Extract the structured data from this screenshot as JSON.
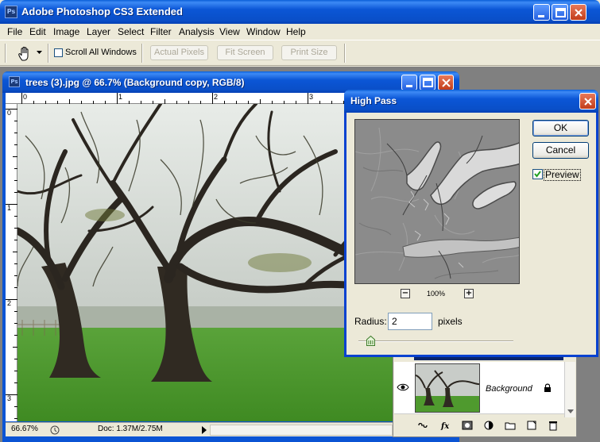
{
  "app": {
    "title": "Adobe Photoshop CS3 Extended",
    "icon_text": "Ps"
  },
  "menu": [
    "File",
    "Edit",
    "Image",
    "Layer",
    "Select",
    "Filter",
    "Analysis",
    "View",
    "Window",
    "Help"
  ],
  "options": {
    "scroll_all_windows": "Scroll All Windows",
    "scroll_all_checked": false,
    "actual_pixels": "Actual Pixels",
    "fit_screen": "Fit Screen",
    "print_size": "Print Size"
  },
  "document": {
    "title": "trees (3).jpg @ 66.7% (Background copy, RGB/8)",
    "icon_text": "Ps",
    "ruler_h": [
      "0",
      "1",
      "2",
      "3"
    ],
    "ruler_v": [
      "0",
      "1",
      "2",
      "3"
    ],
    "zoom": "66.67%",
    "doc_size": "Doc: 1.37M/2.75M"
  },
  "layers": {
    "background_name": "Background"
  },
  "dialog": {
    "title": "High Pass",
    "ok": "OK",
    "cancel": "Cancel",
    "preview_label": "Preview",
    "preview_checked": true,
    "zoom_minus": "−",
    "zoom_plus": "+",
    "zoom_level": "100%",
    "radius_label": "Radius:",
    "radius_value": "2",
    "units": "pixels",
    "slider_fraction": 0.08
  },
  "colors": {
    "title_blue": "#0b56d6",
    "grass_green": "#4f9a2e",
    "highpass_gray": "#8d8d8d"
  }
}
